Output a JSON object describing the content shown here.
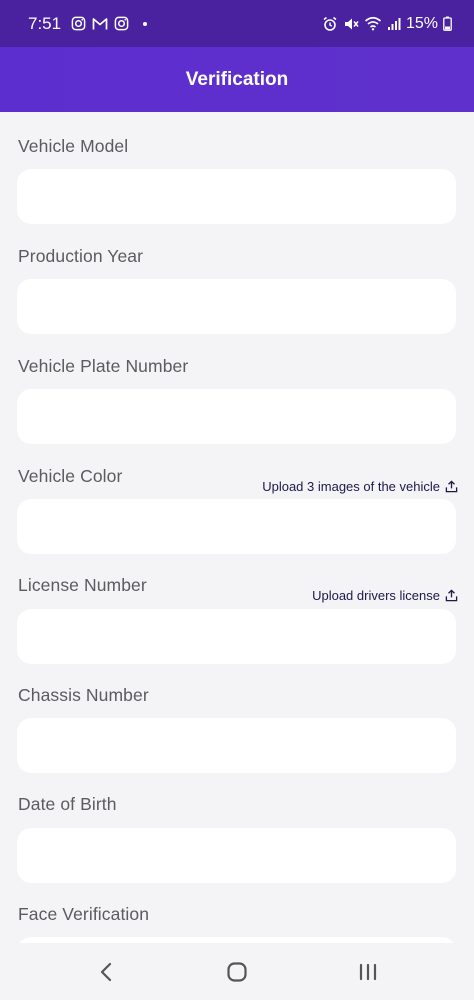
{
  "status_bar": {
    "time": "7:51",
    "left_icons": [
      "instagram-icon",
      "gmail-icon",
      "instagram-icon"
    ],
    "right_icons": [
      "alarm-icon",
      "mute-icon",
      "wifi-icon",
      "signal-icon"
    ],
    "battery": "15%"
  },
  "app_bar": {
    "title": "Verification"
  },
  "fields": [
    {
      "label": "Vehicle Model",
      "value": ""
    },
    {
      "label": "Production Year",
      "value": ""
    },
    {
      "label": "Vehicle Plate Number",
      "value": ""
    },
    {
      "label": "Vehicle Color",
      "value": "",
      "upload_label": "Upload 3 images of the vehicle"
    },
    {
      "label": "License Number",
      "value": "",
      "upload_label": "Upload drivers license"
    },
    {
      "label": "Chassis Number",
      "value": ""
    },
    {
      "label": "Date of Birth",
      "value": ""
    },
    {
      "label": "Face Verification",
      "value": ""
    }
  ],
  "nav_bar": {
    "icons": [
      "back-icon",
      "home-icon",
      "recents-icon"
    ]
  },
  "colors": {
    "status_bar": "#4a22a0",
    "app_bar": "#5d2ecf",
    "background": "#f4f3f5",
    "link": "#1c1a4a"
  }
}
